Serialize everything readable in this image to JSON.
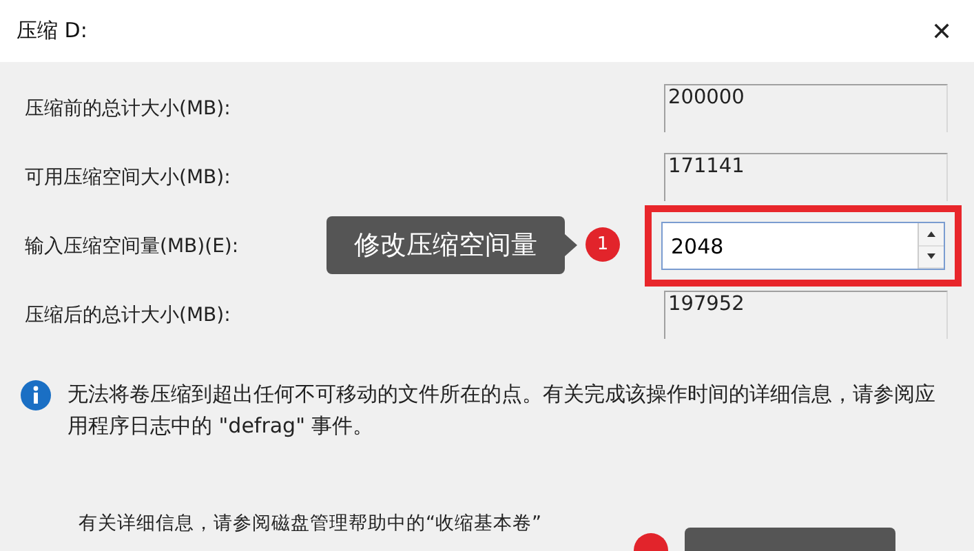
{
  "window": {
    "title": "压缩 D:",
    "close": "✕"
  },
  "fields": [
    {
      "label": "压缩前的总计大小(MB):",
      "value": "200000",
      "kind": "readonly"
    },
    {
      "label": "可用压缩空间大小(MB):",
      "value": "171141",
      "kind": "readonly"
    },
    {
      "label": "输入压缩空间量(MB)(E):",
      "value": "2048",
      "kind": "spin",
      "highlighted": true
    },
    {
      "label": "压缩后的总计大小(MB):",
      "value": "197952",
      "kind": "readonly"
    }
  ],
  "callout": {
    "text": "修改压缩空间量",
    "badge": "1"
  },
  "info": "无法将卷压缩到超出任何不可移动的文件所在的点。有关完成该操作时间的详细信息，请参阅应用程序日志中的 \"defrag\" 事件。",
  "help": "有关详细信息，请参阅磁盘管理帮助中的“收缩基本卷”"
}
